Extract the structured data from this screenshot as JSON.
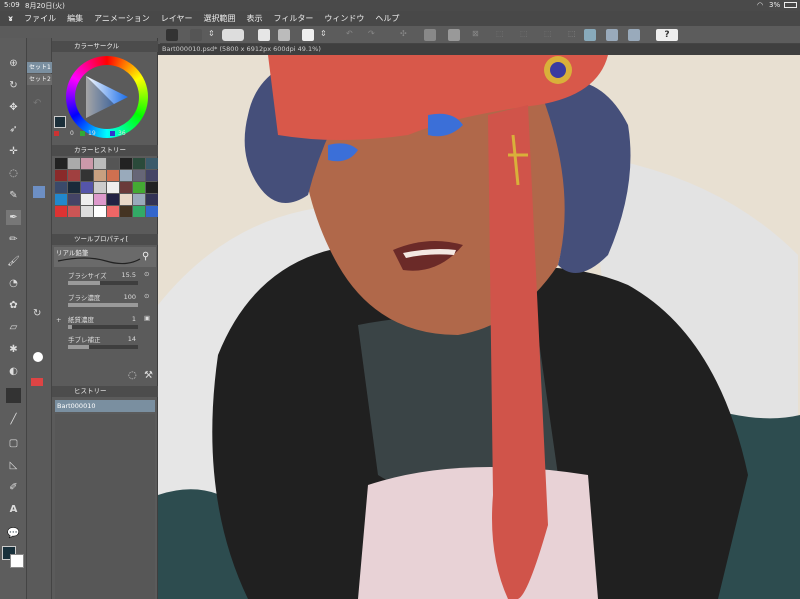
{
  "status": {
    "time": "5:09",
    "date": "8月20日(火)",
    "battery": "3%"
  },
  "menu": [
    "ファイル",
    "編集",
    "アニメーション",
    "レイヤー",
    "選択範囲",
    "表示",
    "フィルター",
    "ウィンドウ",
    "ヘルプ"
  ],
  "set_tabs": [
    "セット1",
    "セット2"
  ],
  "color_circle": {
    "title": "カラーサークル",
    "h": "0",
    "s": "19",
    "v": "36"
  },
  "color_history": {
    "title": "カラーヒストリー"
  },
  "tool_property": {
    "title": "ツールプロパティ[",
    "brush_name": "リアル鉛筆",
    "rows": [
      {
        "label": "ブラシサイズ",
        "value": "15.5",
        "fill": 0.45
      },
      {
        "label": "ブラシ濃度",
        "value": "100",
        "fill": 1.0
      },
      {
        "label": "紙質濃度",
        "value": "1",
        "fill": 0.05
      },
      {
        "label": "手ブレ補正",
        "value": "14",
        "fill": 0.3
      }
    ]
  },
  "history": {
    "title": "ヒストリー",
    "item": "Bart000010"
  },
  "document": {
    "tab": "Bart000010.psd* (5800 x 6912px 600dpi 49.1%)"
  },
  "colors": {
    "accent_blue": "#3b6fd8",
    "bandana_red": "#d8584a",
    "skin": "#b0684a",
    "hair": "#454f7a"
  }
}
